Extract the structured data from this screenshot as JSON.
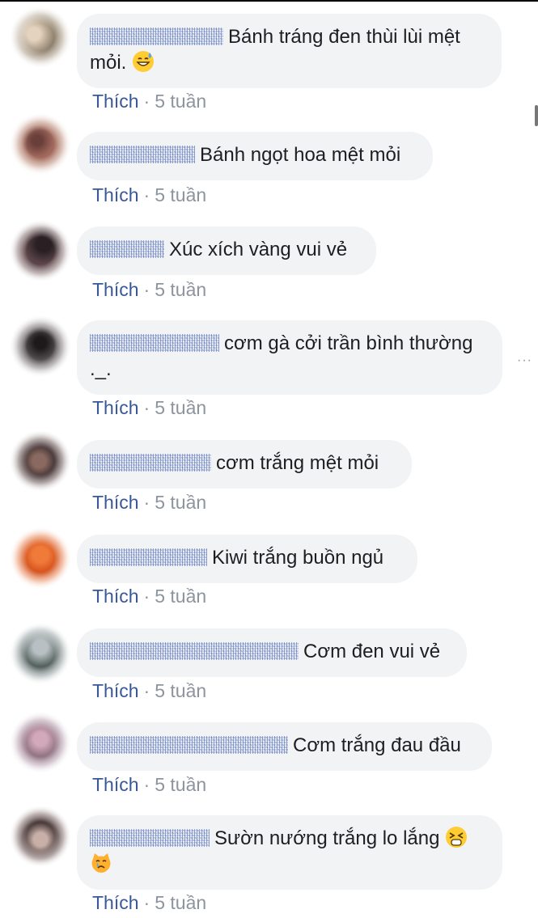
{
  "action_like": "Thích",
  "separator": "·",
  "more_icon": "···",
  "comments": [
    {
      "text": "Bánh tráng đen thùi lùi mệt mỏi.",
      "emoji": "grinning-sweat-icon",
      "time": "5 tuần"
    },
    {
      "text": "Bánh ngọt hoa mệt mỏi",
      "time": "5 tuần"
    },
    {
      "text": "Xúc xích vàng vui vẻ",
      "time": "5 tuần"
    },
    {
      "text": "cơm gà cởi trần bình thường ._.",
      "time": "5 tuần"
    },
    {
      "text": "cơm trắng mệt mỏi",
      "time": "5 tuần"
    },
    {
      "text": "Kiwi trắng buồn ngủ",
      "time": "5 tuần"
    },
    {
      "text": "Cơm đen vui vẻ",
      "time": "5 tuần"
    },
    {
      "text": "Cơm trắng đau đầu",
      "time": "5 tuần"
    },
    {
      "text": "Sườn nướng trắng lo lắng",
      "emoji": "tired-face-icon",
      "emoji2": "crying-cat-icon",
      "time": "5 tuần"
    }
  ],
  "colors": {
    "bubble": "#f2f3f5",
    "like_link": "#385898",
    "meta": "#8d949e",
    "text": "#1c1e21"
  }
}
